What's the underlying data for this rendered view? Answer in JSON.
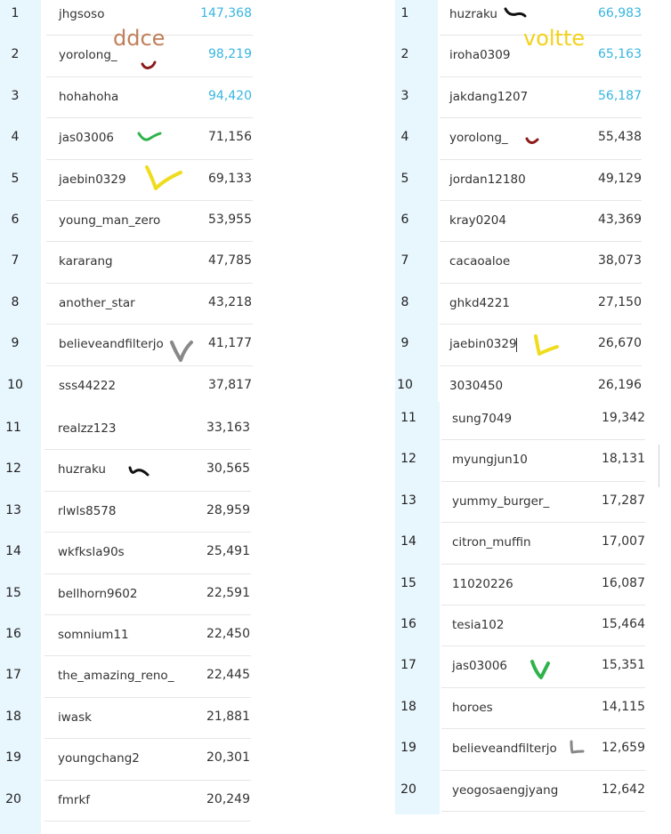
{
  "panels": [
    {
      "title": "ddce",
      "title_color": "#c07f5a",
      "rows": [
        {
          "rank": "1",
          "name": "jhgsoso",
          "score": "147,368",
          "top": true
        },
        {
          "rank": "2",
          "name": "yorolong_",
          "score": "98,219",
          "top": true
        },
        {
          "rank": "3",
          "name": "hohahoha",
          "score": "94,420",
          "top": true
        },
        {
          "rank": "4",
          "name": "jas03006",
          "score": "71,156",
          "top": false
        },
        {
          "rank": "5",
          "name": "jaebin0329",
          "score": "69,133",
          "top": false
        },
        {
          "rank": "6",
          "name": "young_man_zero",
          "score": "53,955",
          "top": false
        },
        {
          "rank": "7",
          "name": "kararang",
          "score": "47,785",
          "top": false
        },
        {
          "rank": "8",
          "name": "another_star",
          "score": "43,218",
          "top": false
        },
        {
          "rank": "9",
          "name": "believeandfilterjo",
          "score": "41,177",
          "top": false
        },
        {
          "rank": "10",
          "name": "sss44222",
          "score": "37,817",
          "top": false
        },
        {
          "rank": "11",
          "name": "realzz123",
          "score": "33,163",
          "top": false
        },
        {
          "rank": "12",
          "name": "huzraku",
          "score": "30,565",
          "top": false
        },
        {
          "rank": "13",
          "name": "rlwls8578",
          "score": "28,959",
          "top": false
        },
        {
          "rank": "14",
          "name": "wkfksla90s",
          "score": "25,491",
          "top": false
        },
        {
          "rank": "15",
          "name": "bellhorn9602",
          "score": "22,591",
          "top": false
        },
        {
          "rank": "16",
          "name": "somnium11",
          "score": "22,450",
          "top": false
        },
        {
          "rank": "17",
          "name": "the_amazing_reno_",
          "score": "22,445",
          "top": false
        },
        {
          "rank": "18",
          "name": "iwask",
          "score": "21,881",
          "top": false
        },
        {
          "rank": "19",
          "name": "youngchang2",
          "score": "20,301",
          "top": false
        },
        {
          "rank": "20",
          "name": "fmrkf",
          "score": "20,249",
          "top": false
        }
      ]
    },
    {
      "title": "voltte",
      "title_color": "#f2d21a",
      "rows": [
        {
          "rank": "1",
          "name": "huzraku",
          "score": "66,983",
          "top": true
        },
        {
          "rank": "2",
          "name": "iroha0309",
          "score": "65,163",
          "top": true
        },
        {
          "rank": "3",
          "name": "jakdang1207",
          "score": "56,187",
          "top": true
        },
        {
          "rank": "4",
          "name": "yorolong_",
          "score": "55,438",
          "top": false
        },
        {
          "rank": "5",
          "name": "jordan12180",
          "score": "49,129",
          "top": false
        },
        {
          "rank": "6",
          "name": "kray0204",
          "score": "43,369",
          "top": false
        },
        {
          "rank": "7",
          "name": "cacaoaloe",
          "score": "38,073",
          "top": false
        },
        {
          "rank": "8",
          "name": "ghkd4221",
          "score": "27,150",
          "top": false
        },
        {
          "rank": "9",
          "name": "jaebin0329",
          "score": "26,670",
          "top": false
        },
        {
          "rank": "10",
          "name": "3030450",
          "score": "26,196",
          "top": false
        },
        {
          "rank": "11",
          "name": "sung7049",
          "score": "19,342",
          "top": false
        },
        {
          "rank": "12",
          "name": "myungjun10",
          "score": "18,131",
          "top": false
        },
        {
          "rank": "13",
          "name": "yummy_burger_",
          "score": "17,287",
          "top": false
        },
        {
          "rank": "14",
          "name": "citron_muffin",
          "score": "17,007",
          "top": false
        },
        {
          "rank": "15",
          "name": "11020226",
          "score": "16,087",
          "top": false
        },
        {
          "rank": "16",
          "name": "tesia102",
          "score": "15,464",
          "top": false
        },
        {
          "rank": "17",
          "name": "jas03006",
          "score": "15,351",
          "top": false
        },
        {
          "rank": "18",
          "name": "horoes",
          "score": "14,115",
          "top": false
        },
        {
          "rank": "19",
          "name": "believeandfilterjo",
          "score": "12,659",
          "top": false
        },
        {
          "rank": "20",
          "name": "yeogosaengjyang",
          "score": "12,642",
          "top": false
        }
      ]
    }
  ],
  "colors": {
    "accent": "#38b6e0",
    "rank_strip": "#e8f6fd",
    "mark_green": "#2db34a",
    "mark_yellow": "#f0dc1e",
    "mark_gray": "#888888",
    "mark_black": "#111111",
    "mark_darkred": "#8b1a1a"
  }
}
